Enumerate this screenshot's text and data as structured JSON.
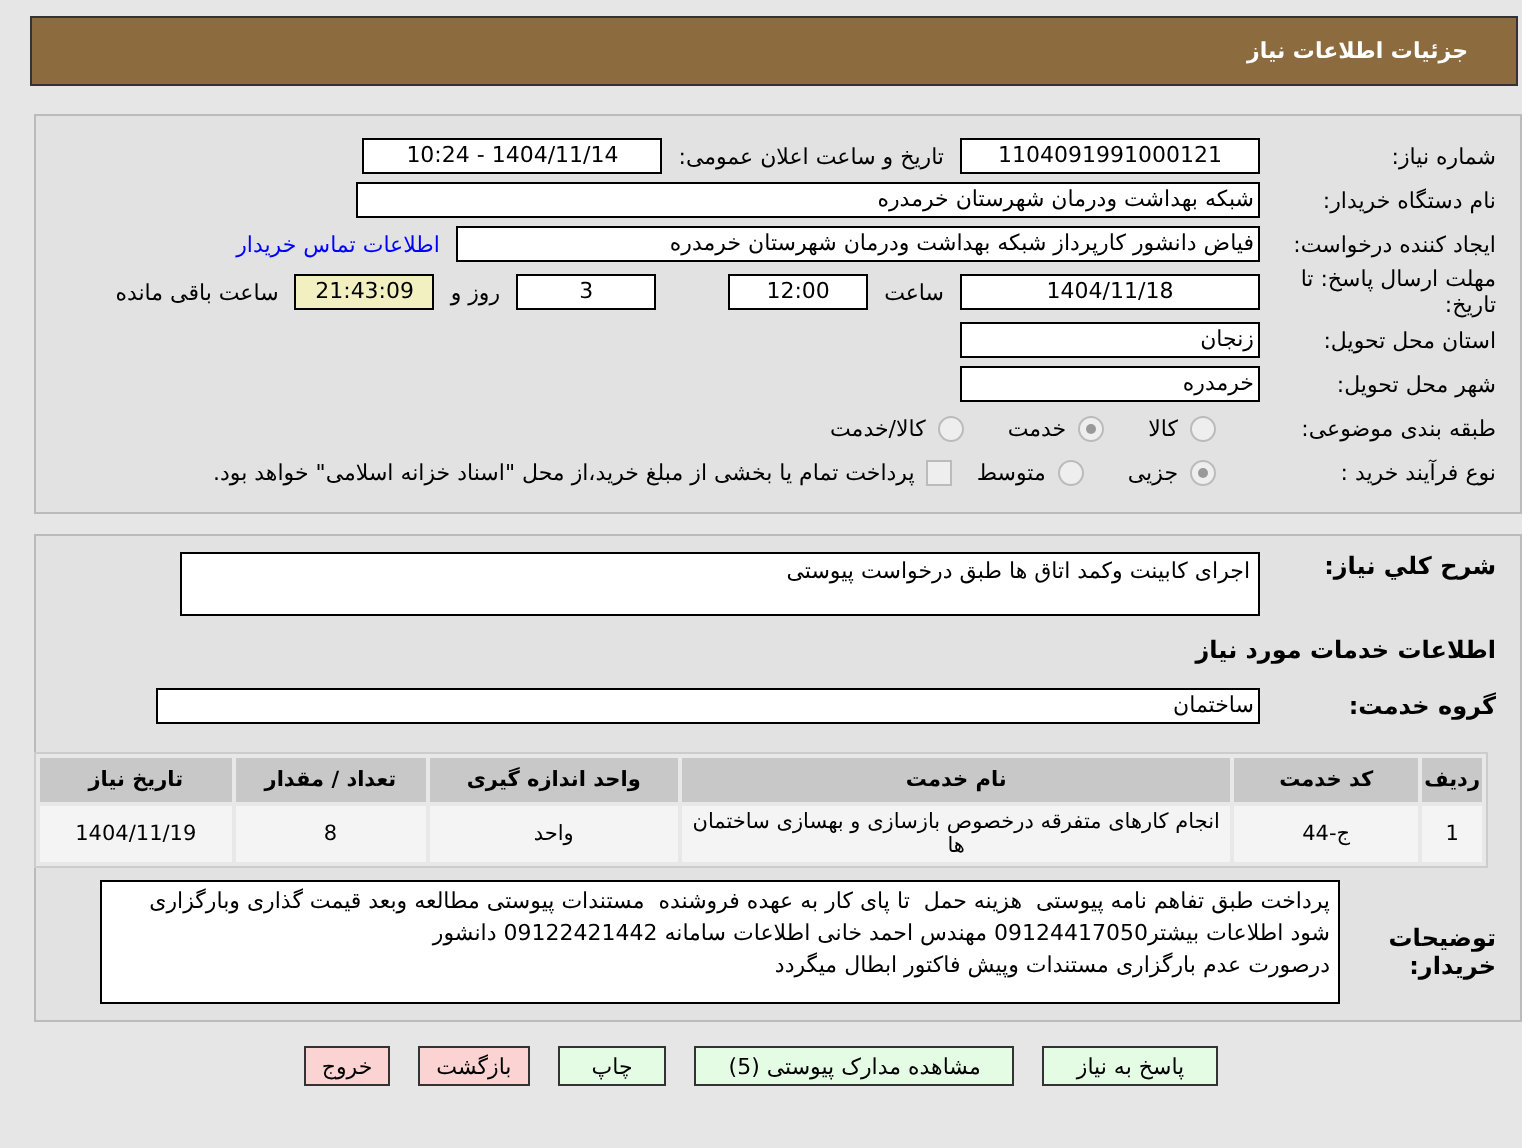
{
  "header": {
    "title": "جزئیات اطلاعات نیاز"
  },
  "fields": {
    "need_number_label": "شماره نیاز:",
    "need_number": "1104091991000121",
    "announce_label": "تاریخ و ساعت اعلان عمومی:",
    "announce": "1404/11/14 - 10:24",
    "buyer_label": "نام دستگاه خریدار:",
    "buyer": "شبکه بهداشت ودرمان شهرستان خرمدره",
    "creator_label": "ایجاد کننده درخواست:",
    "creator": "فیاض دانشور کارپرداز شبکه بهداشت ودرمان شهرستان خرمدره",
    "contact_link": "اطلاعات تماس خریدار",
    "deadline_label": "مهلت ارسال پاسخ: تا تاریخ:",
    "deadline_date": "1404/11/18",
    "time_label": "ساعت",
    "deadline_time": "12:00",
    "days": "3",
    "days_label": "روز و",
    "remaining": "21:43:09",
    "remaining_label": "ساعت باقی مانده",
    "province_label": "استان محل تحویل:",
    "province": "زنجان",
    "city_label": "شهر محل تحویل:",
    "city": "خرمدره"
  },
  "category": {
    "label": "طبقه بندی موضوعی:",
    "options": [
      {
        "label": "کالا",
        "selected": false
      },
      {
        "label": "خدمت",
        "selected": true
      },
      {
        "label": "کالا/خدمت",
        "selected": false
      }
    ]
  },
  "purchase": {
    "label": "نوع فرآیند خرید :",
    "options": [
      {
        "label": "جزیی",
        "selected": true
      },
      {
        "label": "متوسط",
        "selected": false
      }
    ],
    "payment_checkbox": {
      "label": "پرداخت تمام یا بخشی از مبلغ خرید،از محل \"اسناد خزانه اسلامی\" خواهد بود.",
      "checked": false
    }
  },
  "summary": {
    "label": "شرح کلي نياز:",
    "value": "اجرای کابینت وکمد اتاق ها طبق درخواست پیوستی"
  },
  "services_title": "اطلاعات خدمات مورد نياز",
  "service_group": {
    "label": "گروه خدمت:",
    "value": "ساختمان"
  },
  "table": {
    "columns": [
      "ردیف",
      "کد خدمت",
      "نام خدمت",
      "واحد اندازه گیری",
      "تعداد / مقدار",
      "تاریخ نیاز"
    ],
    "rows": [
      [
        "1",
        "ج-44",
        "انجام کارهای متفرقه درخصوص بازسازی و بهسازی ساختمان ها",
        "واحد",
        "8",
        "1404/11/19"
      ]
    ]
  },
  "buyer_notes": {
    "label": "توضیحات خریدار:",
    "value": "پرداخت طبق تفاهم نامه پیوستی  هزینه حمل  تا پای کار به عهده فروشنده  مستندات پیوستی مطالعه وبعد قیمت گذاری وبارگزاری شود اطلاعات بیشتر09124417050 مهندس احمد خانی اطلاعات سامانه 09122421442 دانشور\nدرصورت عدم بارگزاری مستندات وپیش فاکتور ابطال میگردد"
  },
  "buttons": [
    {
      "label": "پاسخ به نیاز",
      "kind": "green"
    },
    {
      "label": "مشاهده مدارک پیوستی (5)",
      "kind": "green"
    },
    {
      "label": "چاپ",
      "kind": "green"
    },
    {
      "label": "بازگشت",
      "kind": "red"
    },
    {
      "label": "خروج",
      "kind": "red"
    }
  ]
}
